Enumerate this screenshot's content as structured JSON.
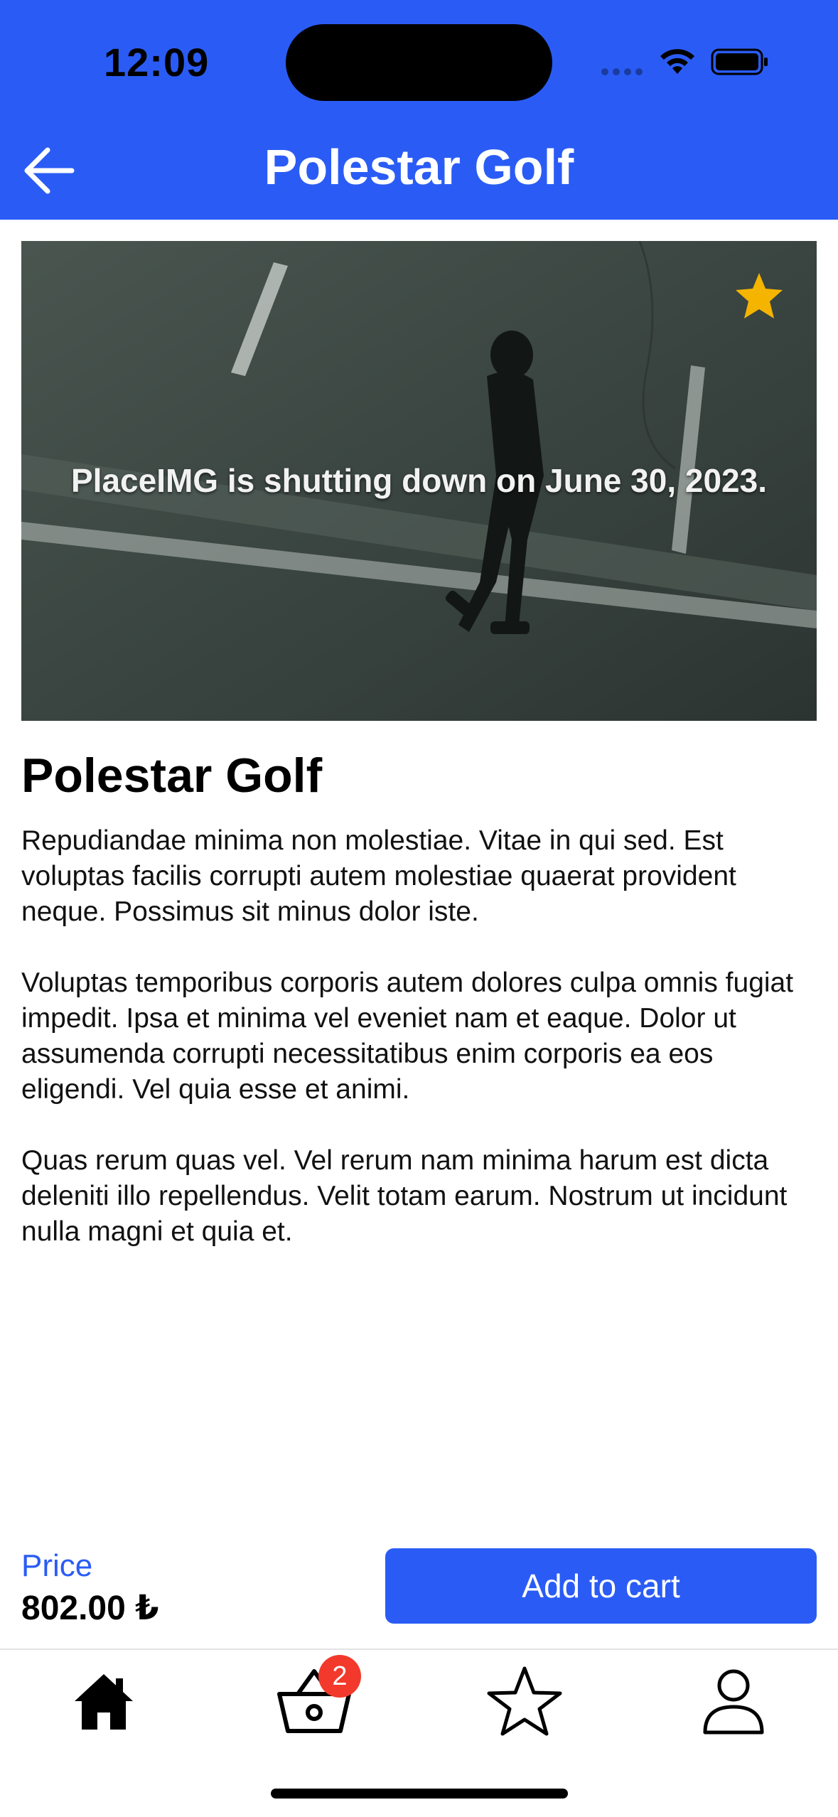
{
  "status_bar": {
    "time": "12:09"
  },
  "header": {
    "title": "Polestar Golf"
  },
  "image": {
    "notice": "PlaceIMG is shutting down on June 30, 2023."
  },
  "product": {
    "title": "Polestar Golf",
    "description": [
      "Repudiandae minima non molestiae. Vitae in qui sed. Est voluptas facilis corrupti autem molestiae quaerat provident neque. Possimus sit minus dolor iste.",
      "Voluptas temporibus corporis autem dolores culpa omnis fugiat impedit. Ipsa et minima vel eveniet nam et eaque. Dolor ut assumenda corrupti necessitatibus enim corporis ea eos eligendi. Vel quia esse et animi.",
      "Quas rerum quas vel. Vel rerum nam minima harum est dicta deleniti illo repellendus. Velit totam earum. Nostrum ut incidunt nulla magni et quia et."
    ],
    "price_label": "Price",
    "price_value": "802.00 ₺",
    "favorite": true
  },
  "actions": {
    "add_to_cart_label": "Add to cart"
  },
  "tabbar": {
    "tabs": [
      {
        "icon": "home-icon",
        "active": true
      },
      {
        "icon": "basket-icon",
        "active": false
      },
      {
        "icon": "star-icon",
        "active": false
      },
      {
        "icon": "person-icon",
        "active": false
      }
    ],
    "cart_badge": "2"
  },
  "colors": {
    "primary": "#2a5cf5",
    "favorite": "#f5b400",
    "badge": "#f2392b"
  }
}
